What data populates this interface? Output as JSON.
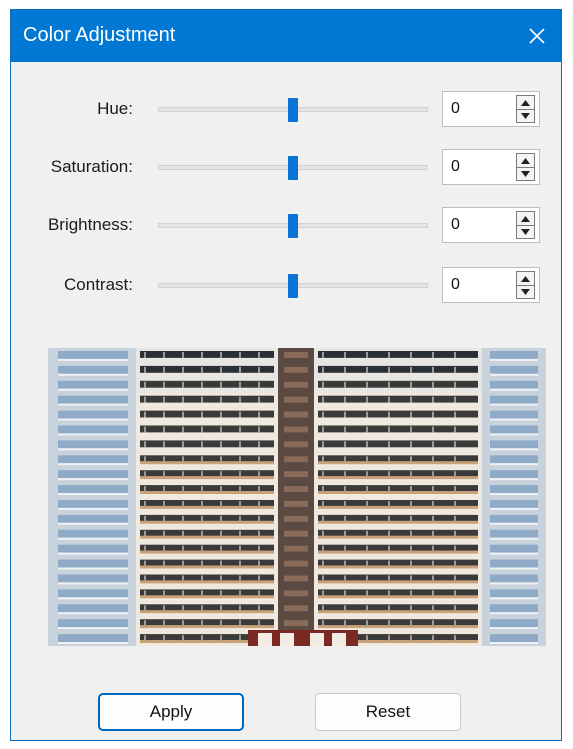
{
  "window": {
    "title": "Color Adjustment",
    "accent_color": "#0078d4",
    "close_icon": "close-icon"
  },
  "controls": [
    {
      "label": "Hue:",
      "value": "0",
      "slider_fraction": 0.5
    },
    {
      "label": "Saturation:",
      "value": "0",
      "slider_fraction": 0.5
    },
    {
      "label": "Brightness:",
      "value": "0",
      "slider_fraction": 0.5
    },
    {
      "label": "Contrast:",
      "value": "0",
      "slider_fraction": 0.5
    }
  ],
  "preview": {
    "description_icon": "building-facade-image"
  },
  "buttons": {
    "apply": "Apply",
    "reset": "Reset"
  }
}
